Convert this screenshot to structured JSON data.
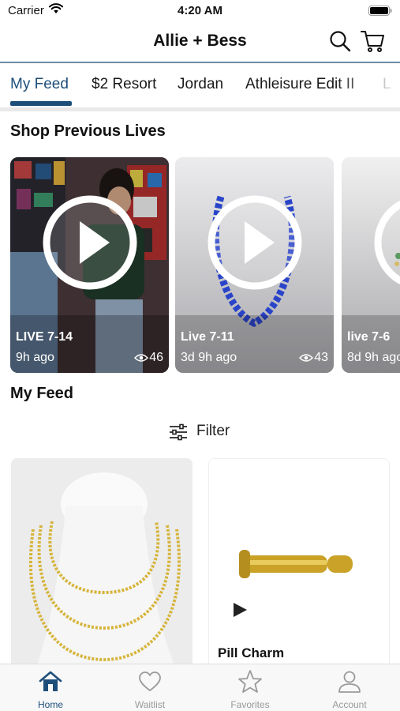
{
  "status_bar": {
    "carrier": "Carrier",
    "time": "4:20 AM"
  },
  "header": {
    "title": "Allie + Bess"
  },
  "tabs": [
    {
      "label": "My Feed",
      "active": true
    },
    {
      "label": "$2 Resort",
      "active": false
    },
    {
      "label": "Jordan",
      "active": false
    },
    {
      "label": "Athleisure Edit II",
      "active": false
    },
    {
      "label": "L",
      "active": false
    }
  ],
  "lives_section": {
    "title": "Shop Previous Lives",
    "items": [
      {
        "label": "LIVE 7-14",
        "ago": "9h ago",
        "views": "46"
      },
      {
        "label": "Live 7-11",
        "ago": "3d 9h ago",
        "views": "43"
      },
      {
        "label": "live 7-6",
        "ago": "8d 9h ago",
        "views": ""
      }
    ]
  },
  "feed_section": {
    "title": "My Feed",
    "filter_label": "Filter"
  },
  "products": [
    {
      "name": ""
    },
    {
      "name": "Pill Charm"
    }
  ],
  "tab_bar": {
    "items": [
      {
        "label": "Home",
        "icon": "home-icon",
        "active": true
      },
      {
        "label": "Waitlist",
        "icon": "heart-icon",
        "active": false
      },
      {
        "label": "Favorites",
        "icon": "star-icon",
        "active": false
      },
      {
        "label": "Account",
        "icon": "person-icon",
        "active": false
      }
    ]
  },
  "colors": {
    "accent": "#1d4e7a",
    "tab_inactive": "#9a9a9a",
    "divider": "#6f8ca5"
  }
}
